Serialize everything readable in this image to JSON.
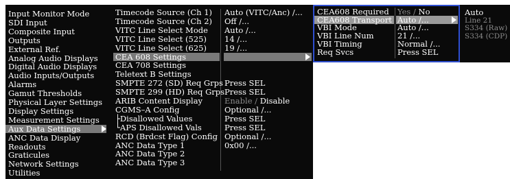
{
  "level1": [
    "Input Monitor Mode",
    "SDI Input",
    "Composite Input",
    "Outputs",
    "External Ref.",
    "Analog Audio Displays",
    "Digital Audio Displays",
    "Audio Inputs/Outputs",
    "Alarms",
    "Gamut Thresholds",
    "Physical Layer Settings",
    "Display Settings",
    "Measurement Settings",
    "Aux Data Settings",
    "ANC Data Display",
    "Readouts",
    "Graticules",
    "Network Settings",
    "Utilities"
  ],
  "level1_selected_index": 13,
  "level2": [
    {
      "label": "Timecode Source (Ch 1)",
      "value": "Auto (VITC/Anc) /..."
    },
    {
      "label": "Timecode Source (Ch 2)",
      "value": "Off /..."
    },
    {
      "label": "VITC Line Select Mode",
      "value": "Auto /..."
    },
    {
      "label": "VITC Line Select (525)",
      "value": "14  /..."
    },
    {
      "label": "VITC Line Select (625)",
      "value": "19  /..."
    },
    {
      "label": "CEA 608 Settings",
      "value": ""
    },
    {
      "label": "CEA 708 Settings",
      "value": ""
    },
    {
      "label": "Teletext B Settings",
      "value": ""
    },
    {
      "label": "SMPTE 272 (SD) Req Grps",
      "value": "Press SEL"
    },
    {
      "label": "SMPTE 299 (HD) Req Grps",
      "value": "Press SEL"
    },
    {
      "label": "ARIB Content Display",
      "value": ""
    },
    {
      "label": "CGMS–A Config",
      "value": "Optional /..."
    },
    {
      "label": "├Disallowed Values",
      "value": "Press SEL"
    },
    {
      "label": "└APS Disallowed Vals",
      "value": "Press SEL"
    },
    {
      "label": "RCD (Brdcst Flag) Config",
      "value": "Optional /..."
    },
    {
      "label": "ANC Data Type 1",
      "value": "0x00 /..."
    },
    {
      "label": "ANC Data Type 2",
      "value": ""
    },
    {
      "label": "ANC Data Type 3",
      "value": ""
    }
  ],
  "level2_selected_index": 5,
  "arib": {
    "enable": "Enable",
    "sep": " / ",
    "disable": "Disable"
  },
  "level3": [
    {
      "label": "CEA608 Required",
      "value": ""
    },
    {
      "label": "CEA608 Transport",
      "value": "Auto /..."
    },
    {
      "label": "VBI Mode",
      "value": "Auto /..."
    },
    {
      "label": "VBI Line Num",
      "value": " 21  /..."
    },
    {
      "label": "VBI Timing",
      "value": "Normal /..."
    },
    {
      "label": "Req Svcs",
      "value": "Press SEL"
    }
  ],
  "level3_selected_index": 1,
  "cea608_required": {
    "yes": "Yes",
    "sep": " / ",
    "no": "No"
  },
  "level4": [
    "Auto",
    "Line 21",
    "S334 (Raw)",
    "S334 (CDP)"
  ],
  "colors": {
    "menu_bg": "#0a0a0a",
    "selected_bg": "#7a7a7a",
    "focus_border": "#2f4fd0",
    "dim_text": "#8c8c8c"
  }
}
